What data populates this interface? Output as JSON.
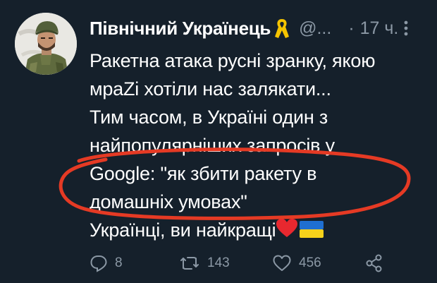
{
  "author": {
    "display_name": "Північний Українець",
    "handle": "@...",
    "separator": "·",
    "time": "17 ч.",
    "badge_icon": "yellow-ribbon-icon",
    "avatar": "soldier-avatar"
  },
  "tweet": {
    "lines": [
      "Ракетна атака русні зранку, якою",
      "мраZі хотіли нас залякати...",
      "Тим часом, в Україні один з",
      "найпопулярніших запросів у",
      "Google: \"як збити ракету в",
      "домашніх умовах\"",
      "Українці, ви найкращі"
    ],
    "trailing_emoji": [
      "red-heart-icon",
      "ukraine-flag-icon"
    ]
  },
  "actions": {
    "reply_count": "8",
    "retweet_count": "143",
    "like_count": "456"
  },
  "colors": {
    "background": "#15202b",
    "text": "#ffffff",
    "muted": "#8b98a5",
    "annotation": "#e53a24",
    "ribbon": "#f5c400"
  }
}
